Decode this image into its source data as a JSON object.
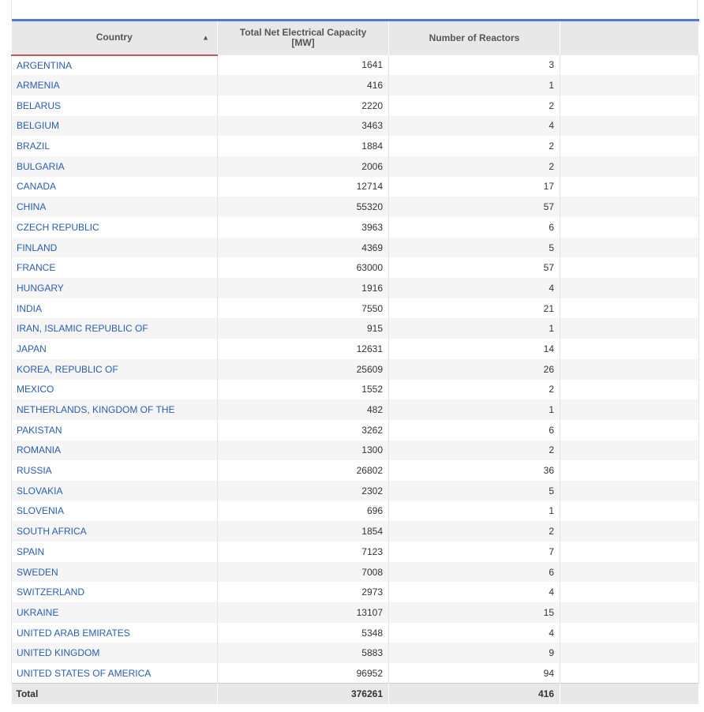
{
  "table": {
    "headers": {
      "country": "Country",
      "capacity_line1": "Total Net Electrical Capacity",
      "capacity_line2": "[MW]",
      "reactors": "Number of Reactors",
      "sort_indicator": "▲"
    },
    "rows": [
      {
        "country": "ARGENTINA",
        "capacity": "1641",
        "reactors": "3"
      },
      {
        "country": "ARMENIA",
        "capacity": "416",
        "reactors": "1"
      },
      {
        "country": "BELARUS",
        "capacity": "2220",
        "reactors": "2"
      },
      {
        "country": "BELGIUM",
        "capacity": "3463",
        "reactors": "4"
      },
      {
        "country": "BRAZIL",
        "capacity": "1884",
        "reactors": "2"
      },
      {
        "country": "BULGARIA",
        "capacity": "2006",
        "reactors": "2"
      },
      {
        "country": "CANADA",
        "capacity": "12714",
        "reactors": "17"
      },
      {
        "country": "CHINA",
        "capacity": "55320",
        "reactors": "57"
      },
      {
        "country": "CZECH REPUBLIC",
        "capacity": "3963",
        "reactors": "6"
      },
      {
        "country": "FINLAND",
        "capacity": "4369",
        "reactors": "5"
      },
      {
        "country": "FRANCE",
        "capacity": "63000",
        "reactors": "57"
      },
      {
        "country": "HUNGARY",
        "capacity": "1916",
        "reactors": "4"
      },
      {
        "country": "INDIA",
        "capacity": "7550",
        "reactors": "21"
      },
      {
        "country": "IRAN, ISLAMIC REPUBLIC OF",
        "capacity": "915",
        "reactors": "1"
      },
      {
        "country": "JAPAN",
        "capacity": "12631",
        "reactors": "14"
      },
      {
        "country": "KOREA, REPUBLIC OF",
        "capacity": "25609",
        "reactors": "26"
      },
      {
        "country": "MEXICO",
        "capacity": "1552",
        "reactors": "2"
      },
      {
        "country": "NETHERLANDS, KINGDOM OF THE",
        "capacity": "482",
        "reactors": "1"
      },
      {
        "country": "PAKISTAN",
        "capacity": "3262",
        "reactors": "6"
      },
      {
        "country": "ROMANIA",
        "capacity": "1300",
        "reactors": "2"
      },
      {
        "country": "RUSSIA",
        "capacity": "26802",
        "reactors": "36"
      },
      {
        "country": "SLOVAKIA",
        "capacity": "2302",
        "reactors": "5"
      },
      {
        "country": "SLOVENIA",
        "capacity": "696",
        "reactors": "1"
      },
      {
        "country": "SOUTH AFRICA",
        "capacity": "1854",
        "reactors": "2"
      },
      {
        "country": "SPAIN",
        "capacity": "7123",
        "reactors": "7"
      },
      {
        "country": "SWEDEN",
        "capacity": "7008",
        "reactors": "6"
      },
      {
        "country": "SWITZERLAND",
        "capacity": "2973",
        "reactors": "4"
      },
      {
        "country": "UKRAINE",
        "capacity": "13107",
        "reactors": "15"
      },
      {
        "country": "UNITED ARAB EMIRATES",
        "capacity": "5348",
        "reactors": "4"
      },
      {
        "country": "UNITED KINGDOM",
        "capacity": "5883",
        "reactors": "9"
      },
      {
        "country": "UNITED STATES OF AMERICA",
        "capacity": "96952",
        "reactors": "94"
      }
    ],
    "total": {
      "label": "Total",
      "capacity": "376261",
      "reactors": "416"
    }
  }
}
